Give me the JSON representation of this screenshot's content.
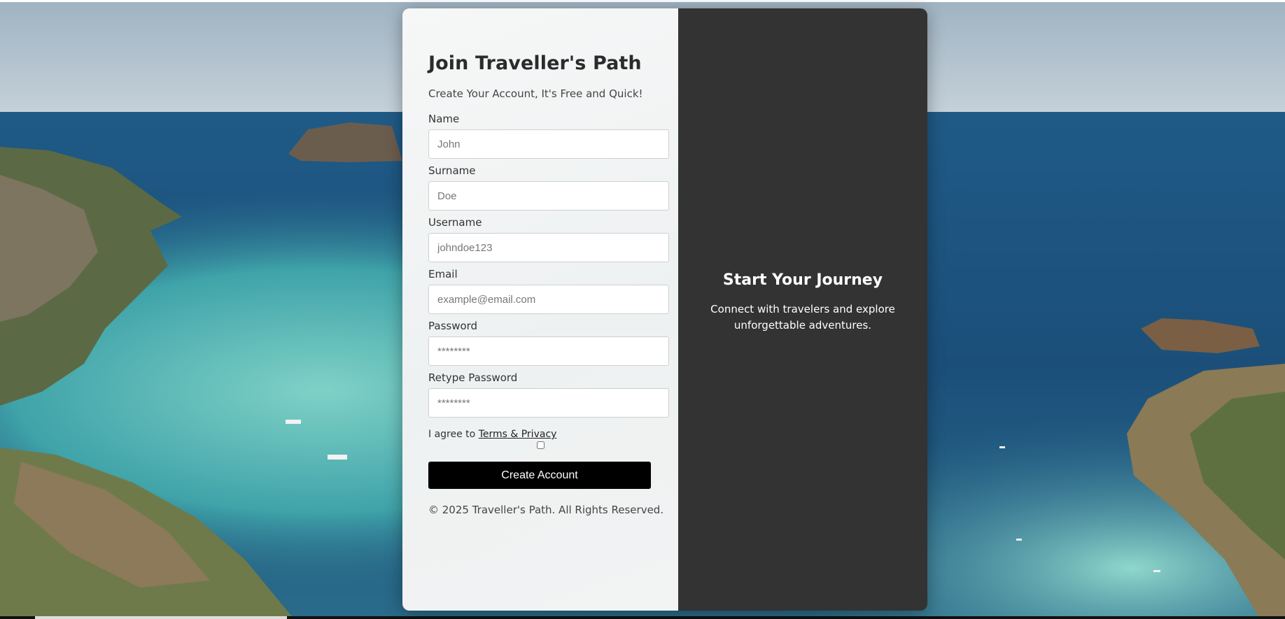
{
  "form": {
    "title": "Join Traveller's Path",
    "subtitle": "Create Your Account, It's Free and Quick!",
    "fields": [
      {
        "label": "Name",
        "placeholder": "John",
        "type": "text"
      },
      {
        "label": "Surname",
        "placeholder": "Doe",
        "type": "text"
      },
      {
        "label": "Username",
        "placeholder": "johndoe123",
        "type": "text"
      },
      {
        "label": "Email",
        "placeholder": "example@email.com",
        "type": "email"
      },
      {
        "label": "Password",
        "placeholder": "********",
        "type": "password"
      },
      {
        "label": "Retype Password",
        "placeholder": "********",
        "type": "password"
      }
    ],
    "agree_prefix": "I agree to ",
    "agree_link": "Terms & Privacy",
    "submit_label": "Create Account",
    "footer": "© 2025 Traveller's Path. All Rights Reserved."
  },
  "info": {
    "title": "Start Your Journey",
    "text": "Connect with travelers and explore unforgettable adventures."
  },
  "colors": {
    "panel_dark": "#333333",
    "button": "#000000",
    "sea_deep": "#1d4e78",
    "sea_shallow": "#5bb7b5"
  },
  "background": {
    "icon": "coastal-bay-landscape"
  }
}
